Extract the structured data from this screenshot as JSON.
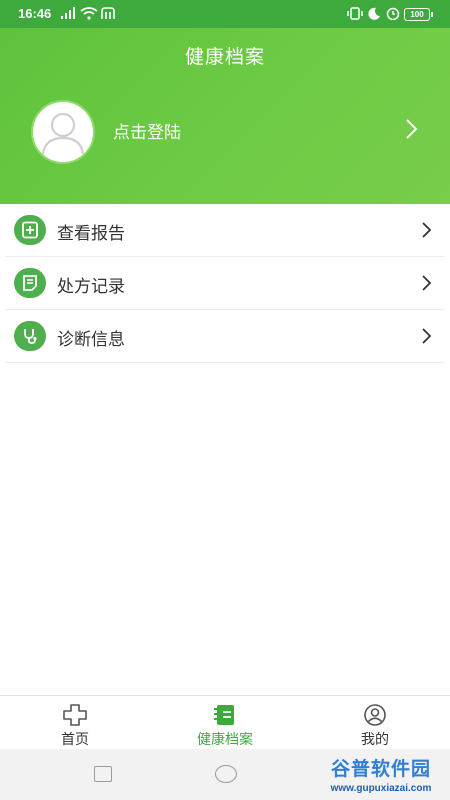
{
  "status_bar": {
    "time": "16:46",
    "battery": "100"
  },
  "header": {
    "title": "健康档案",
    "login_text": "点击登陆"
  },
  "menu": [
    {
      "label": "查看报告",
      "icon": "report-plus-icon"
    },
    {
      "label": "处方记录",
      "icon": "prescription-icon"
    },
    {
      "label": "诊断信息",
      "icon": "stethoscope-icon"
    }
  ],
  "tabs": [
    {
      "label": "首页",
      "icon": "home-cross-icon",
      "active": false
    },
    {
      "label": "健康档案",
      "icon": "health-record-icon",
      "active": true
    },
    {
      "label": "我的",
      "icon": "user-icon",
      "active": false
    }
  ],
  "watermark": {
    "title": "谷普软件园",
    "url": "www.gupuxiazai.com"
  },
  "colors": {
    "primary": "#3eaa3e",
    "header_gradient_start": "#5fc23c",
    "header_gradient_end": "#78cd4a",
    "icon_bg": "#4fae4d"
  }
}
